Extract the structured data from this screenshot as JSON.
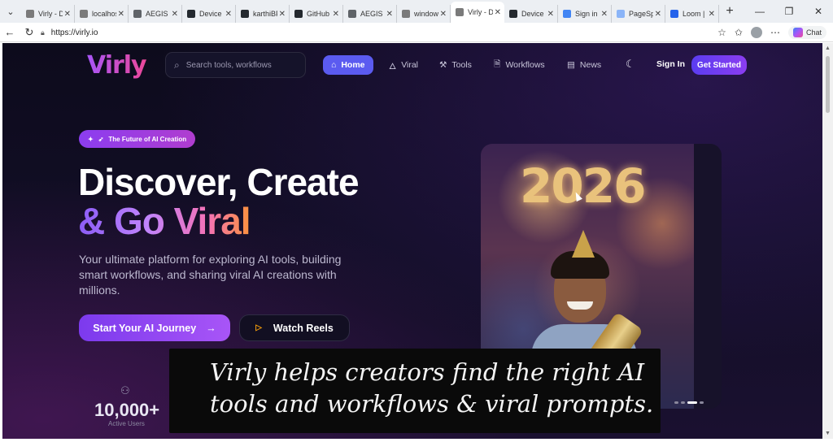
{
  "browser": {
    "tabs": [
      {
        "title": "Virly - D",
        "color": "#7a7a7a"
      },
      {
        "title": "localhos",
        "color": "#7a7a7a"
      },
      {
        "title": "AEGIS II",
        "color": "#5f6368"
      },
      {
        "title": "Device a",
        "color": "#24292f"
      },
      {
        "title": "karthiBF",
        "color": "#24292f"
      },
      {
        "title": "GitHub",
        "color": "#24292f"
      },
      {
        "title": "AEGIS II",
        "color": "#5f6368"
      },
      {
        "title": "window",
        "color": "#7a7a7a"
      },
      {
        "title": "Virly - D",
        "color": "#7a7a7a",
        "active": true
      },
      {
        "title": "Device a",
        "color": "#24292f"
      },
      {
        "title": "Sign in",
        "color": "#4285f4"
      },
      {
        "title": "PageSp",
        "color": "#8ab4f8"
      },
      {
        "title": "Loom |",
        "color": "#2563eb"
      }
    ],
    "url": "https://virly.io",
    "chat_label": "Chat"
  },
  "nav": {
    "logo": "Virly",
    "search_placeholder": "Search tools, workflows",
    "items": [
      {
        "label": "Home",
        "icon": "home-icon"
      },
      {
        "label": "Viral",
        "icon": "flame-icon"
      },
      {
        "label": "Tools",
        "icon": "wrench-icon"
      },
      {
        "label": "Workflows",
        "icon": "document-icon"
      },
      {
        "label": "News",
        "icon": "newspaper-icon"
      }
    ],
    "sign_in": "Sign In",
    "get_started": "Get Started"
  },
  "hero": {
    "badge": "The Future of AI Creation",
    "title_line1": "Discover, Create",
    "title_line2": "& Go Viral",
    "subtitle": "Your ultimate platform for exploring AI tools, building smart workflows, and sharing viral AI creations with millions.",
    "cta_primary": "Start Your AI Journey",
    "cta_secondary": "Watch Reels",
    "stat_value": "10,000+",
    "stat_label": "Active Users",
    "image_text": "2026",
    "carousel": {
      "total": 4,
      "active": 3
    }
  },
  "caption": {
    "line1": "Virly helps creators find the right AI",
    "line2": "tools and workflows & viral prompts."
  },
  "colors": {
    "accent": "#5b5bf0",
    "brand_gradient_start": "#a855f7",
    "brand_gradient_end": "#ec4899",
    "page_bg": "#0d0b1c"
  }
}
